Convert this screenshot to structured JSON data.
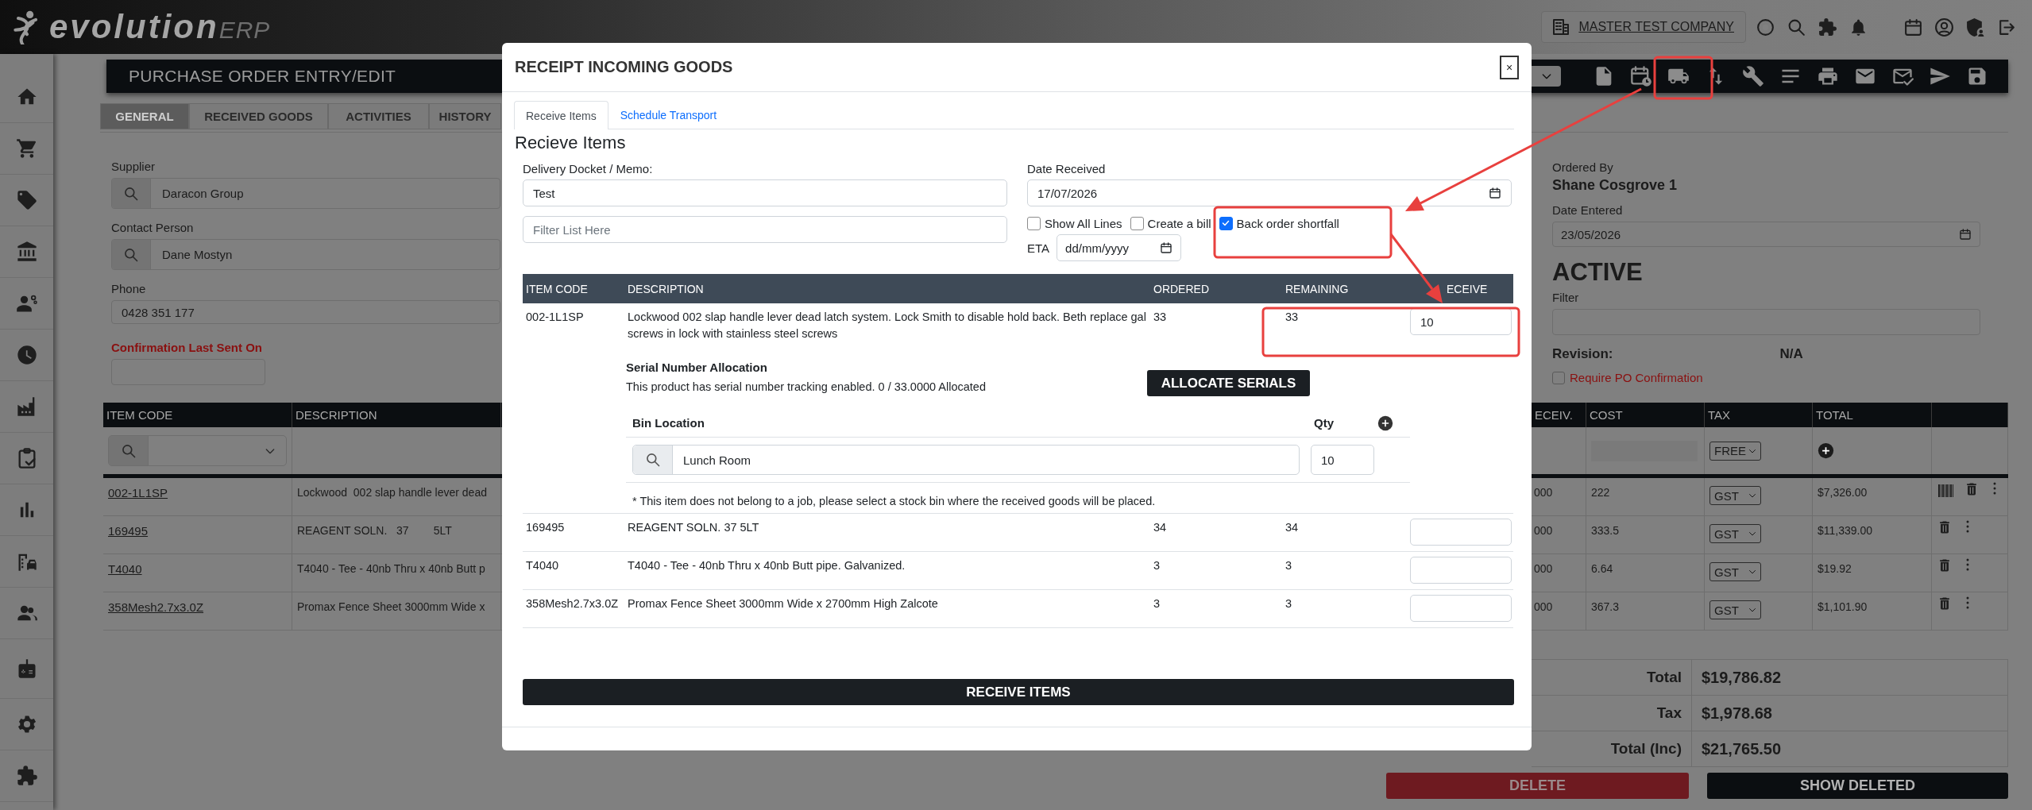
{
  "header": {
    "logo": {
      "text": "evolution",
      "suffix": "ERP"
    },
    "company": "MASTER TEST COMPANY"
  },
  "page": {
    "title": "PURCHASE ORDER ENTRY/EDIT",
    "tabs": [
      {
        "label": "GENERAL",
        "selected": true
      },
      {
        "label": "RECEIVED GOODS",
        "selected": false
      },
      {
        "label": "ACTIVITIES",
        "selected": false
      },
      {
        "label": "HISTORY",
        "selected": false
      }
    ],
    "fields": [
      {
        "label": "Supplier",
        "value": "Daracon Group",
        "kind": "lookup",
        "highlight": false
      },
      {
        "label": "Contact Person",
        "value": "Dane Mostyn",
        "kind": "lookup",
        "highlight": false
      },
      {
        "label": "Phone",
        "value": "0428 351 177",
        "kind": "text",
        "highlight": false
      },
      {
        "label": "Confirmation Last Sent On",
        "kind": "short",
        "highlight": true
      }
    ],
    "ordered_by": {
      "label": "Ordered By",
      "value": "Shane Cosgrove 1"
    },
    "date_entered": {
      "label": "Date Entered",
      "value": "23/05/2026"
    },
    "status": "ACTIVE",
    "filter": {
      "label": "Filter"
    },
    "revision": {
      "label": "Revision:",
      "value": "N/A"
    },
    "require_confirmation": {
      "label": "Require PO Confirmation",
      "checked": false
    },
    "table": {
      "columns": [
        "ITEM CODE",
        "DESCRIPTION",
        "ECEIV.",
        "COST",
        "TAX",
        "TOTAL"
      ],
      "filter_tax": "FREE",
      "rows": [
        {
          "item_code": "002-1L1SP",
          "description": "Lockwood  002 slap handle lever dead",
          "received": "000",
          "cost": "222",
          "tax": "GST",
          "total": "$7,326.00",
          "barcode": true
        },
        {
          "item_code": "169495",
          "description": "REAGENT SOLN.   37        5LT",
          "received": "000",
          "cost": "333.5",
          "tax": "GST",
          "total": "$11,339.00",
          "barcode": false
        },
        {
          "item_code": "T4040",
          "description": "T4040 - Tee - 40nb Thru x 40nb Butt p",
          "received": "000",
          "cost": "6.64",
          "tax": "GST",
          "total": "$19.92",
          "barcode": false
        },
        {
          "item_code": "358Mesh2.7x3.0Z",
          "description": "Promax Fence Sheet 3000mm Wide x",
          "received": "000",
          "cost": "367.3",
          "tax": "GST",
          "total": "$1,101.90",
          "barcode": false
        }
      ]
    },
    "totals": [
      {
        "label": "Total",
        "value": "$19,786.82"
      },
      {
        "label": "Tax",
        "value": "$1,978.68"
      },
      {
        "label": "Total (Inc)",
        "value": "$21,765.50"
      }
    ],
    "buttons": [
      {
        "label": "DELETE",
        "kind": "danger"
      },
      {
        "label": "SHOW DELETED",
        "kind": "dark"
      }
    ]
  },
  "modal": {
    "title": "RECEIPT INCOMING GOODS",
    "close": "×",
    "tabs": [
      {
        "label": "Receive Items",
        "selected": true
      },
      {
        "label": "Schedule Transport",
        "selected": false
      }
    ],
    "heading": "Recieve Items",
    "memo": {
      "label": "Delivery Docket / Memo:",
      "value": "Test"
    },
    "filter": {
      "placeholder": "Filter List Here"
    },
    "date_received": {
      "label": "Date Received",
      "value": "17/07/2026"
    },
    "options": [
      {
        "label": "Show All Lines",
        "checked": false
      },
      {
        "label": "Create a bill",
        "checked": false
      },
      {
        "label": "Back order shortfall",
        "checked": true
      }
    ],
    "eta": {
      "label": "ETA",
      "placeholder": "dd/mm/yyyy"
    },
    "columns": [
      "ITEM CODE",
      "DESCRIPTION",
      "ORDERED",
      "REMAINING",
      "ECEIVE"
    ],
    "rows": [
      {
        "item_code": "002-1L1SP",
        "description": "Lockwood 002 slap handle lever dead latch system. Lock Smith to disable hold back. Beth replace gal screws in lock with stainless steel screws",
        "ordered": "33",
        "remaining": "33",
        "receive": "10",
        "serials": {
          "title": "Serial Number Allocation",
          "text": "This product has serial number tracking enabled. 0 / 33.0000 Allocated",
          "button": "ALLOCATE SERIALS",
          "bin_label": "Bin Location",
          "qty_label": "Qty",
          "bin": "Lunch Room",
          "qty": "10",
          "note": "* This item does not belong to a job, please select a stock bin where the received goods will be placed."
        }
      },
      {
        "item_code": "169495",
        "description": "REAGENT SOLN. 37 5LT",
        "ordered": "34",
        "remaining": "34"
      },
      {
        "item_code": "T4040",
        "description": "T4040 - Tee - 40nb Thru x 40nb Butt pipe. Galvanized.",
        "ordered": "3",
        "remaining": "3"
      },
      {
        "item_code": "358Mesh2.7x3.0Z",
        "description": "Promax Fence Sheet 3000mm Wide x 2700mm High Zalcote",
        "ordered": "3",
        "remaining": "3"
      }
    ],
    "submit": "RECEIVE ITEMS"
  }
}
